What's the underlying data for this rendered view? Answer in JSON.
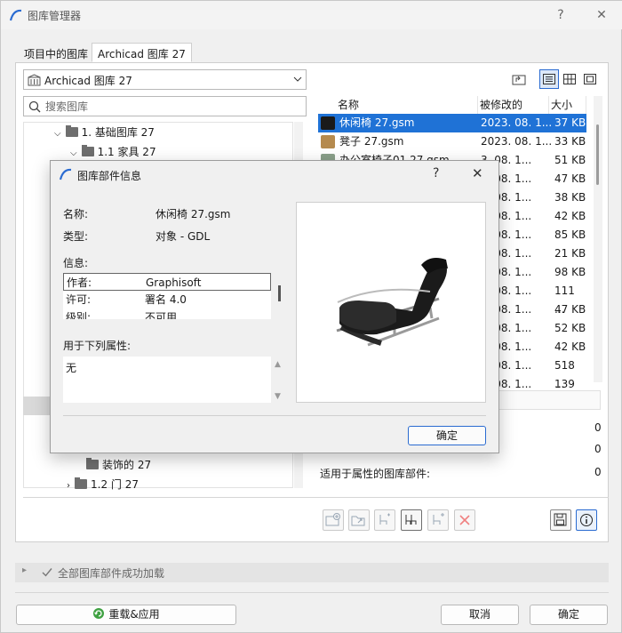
{
  "window": {
    "title": "图库管理器",
    "help": "?",
    "close": "✕"
  },
  "tabs": [
    {
      "label": "项目中的图库"
    },
    {
      "label": "Archicad 图库 27"
    }
  ],
  "library_combo": {
    "value": "Archicad 图库 27"
  },
  "search": {
    "placeholder": "搜索图库"
  },
  "tree": {
    "items": [
      {
        "label": "1. 基础图库 27"
      },
      {
        "label": "1.1 家具 27"
      },
      {
        "label": "装饰的 27"
      },
      {
        "label": "1.2 门 27"
      }
    ]
  },
  "list": {
    "columns": [
      "名称",
      "被修改的",
      "大小"
    ],
    "rows": [
      {
        "name": "休闲椅 27.gsm",
        "modified": "2023. 08. 1...",
        "size": "37 KB"
      },
      {
        "name": "凳子 27.gsm",
        "modified": "2023. 08. 1...",
        "size": "33 KB"
      },
      {
        "name": "办公室椅子01 27.gsm",
        "modified": "3. 08. 1...",
        "size": "51 KB"
      },
      {
        "name": "",
        "modified": "3. 08. 1...",
        "size": "47 KB"
      },
      {
        "name": "",
        "modified": "3. 08. 1...",
        "size": "38 KB"
      },
      {
        "name": "",
        "modified": "3. 08. 1...",
        "size": "42 KB"
      },
      {
        "name": "",
        "modified": "3. 08. 1...",
        "size": "85 KB"
      },
      {
        "name": "",
        "modified": "3. 08. 1...",
        "size": "21 KB"
      },
      {
        "name": "",
        "modified": "3. 08. 1...",
        "size": "98 KB"
      },
      {
        "name": "",
        "modified": "3. 08. 1...",
        "size": "111 ..."
      },
      {
        "name": "",
        "modified": "3. 08. 1...",
        "size": "47 KB"
      },
      {
        "name": "",
        "modified": "3. 08. 1...",
        "size": "52 KB"
      },
      {
        "name": "",
        "modified": "3. 08. 1...",
        "size": "42 KB"
      },
      {
        "name": "",
        "modified": "3. 08. 1...",
        "size": "518 ..."
      },
      {
        "name": "",
        "modified": "3. 08. 1...",
        "size": "139 ..."
      }
    ]
  },
  "stats": {
    "count_1": "0",
    "count_2": "0",
    "applies_label": "适用于属性的图库部件:",
    "applies_value": "0"
  },
  "status": {
    "text": "全部图库部件成功加载"
  },
  "footer": {
    "reload_apply": "重载&应用",
    "cancel": "取消",
    "ok": "确定"
  },
  "dialog": {
    "title": "图库部件信息",
    "help": "?",
    "close": "✕",
    "name_label": "名称:",
    "name_value": "休闲椅 27.gsm",
    "type_label": "类型:",
    "type_value": "对象 - GDL",
    "info_label": "信息:",
    "info_rows": [
      {
        "key": "作者:",
        "value": "Graphisoft"
      },
      {
        "key": "许可:",
        "value": "署名 4.0"
      },
      {
        "key": "级别:",
        "value": "不可用"
      }
    ],
    "used_for_label": "用于下列属性:",
    "used_for_value": "无",
    "ok": "确定"
  },
  "colors": {
    "accent": "#1f72d6",
    "selection_bg": "#1f72d6",
    "tree_selection": "#d9d9d9"
  }
}
